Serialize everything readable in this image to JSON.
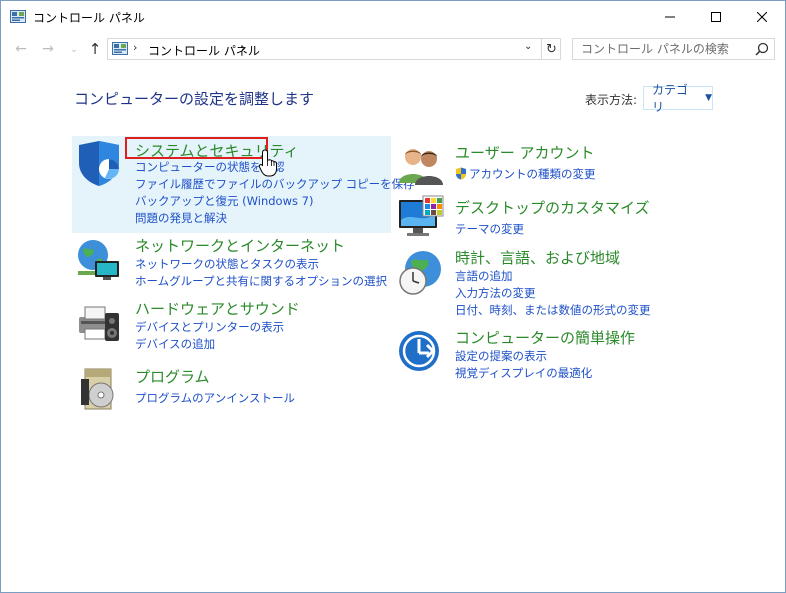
{
  "window": {
    "title": "コントロール パネル",
    "controls": {
      "minimize": "—",
      "maximize": "☐",
      "close": "✕"
    }
  },
  "nav": {
    "back": "←",
    "forward": "→",
    "recent": "⌄",
    "up": "↑",
    "address_sep": "›",
    "address_location": "コントロール パネル",
    "address_dropdown": "⌄",
    "refresh": "↻",
    "search_placeholder": "コントロール パネルの検索"
  },
  "main": {
    "heading": "コンピューターの設定を調整します",
    "view_by_label": "表示方法:",
    "view_by_value": "カテゴリ"
  },
  "categories_left": [
    {
      "title": "システムとセキュリティ",
      "icon": "shield-icon",
      "links": [
        "コンピューターの状態を確認",
        "ファイル履歴でファイルのバックアップ コピーを保存",
        "バックアップと復元 (Windows 7)",
        "問題の発見と解決"
      ]
    },
    {
      "title": "ネットワークとインターネット",
      "icon": "network-globe-icon",
      "links": [
        "ネットワークの状態とタスクの表示",
        "ホームグループと共有に関するオプションの選択"
      ]
    },
    {
      "title": "ハードウェアとサウンド",
      "icon": "printer-speaker-icon",
      "links": [
        "デバイスとプリンターの表示",
        "デバイスの追加"
      ]
    },
    {
      "title": "プログラム",
      "icon": "program-disc-icon",
      "links": [
        "プログラムのアンインストール"
      ]
    }
  ],
  "categories_right": [
    {
      "title": "ユーザー アカウント",
      "icon": "users-icon",
      "links": [
        "アカウントの種類の変更"
      ]
    },
    {
      "title": "デスクトップのカスタマイズ",
      "icon": "monitor-palette-icon",
      "links": [
        "テーマの変更"
      ]
    },
    {
      "title": "時計、言語、および地域",
      "icon": "clock-globe-icon",
      "links": [
        "言語の追加",
        "入力方法の変更",
        "日付、時刻、または数値の形式の変更"
      ]
    },
    {
      "title": "コンピューターの簡単操作",
      "icon": "ease-of-access-icon",
      "links": [
        "設定の提案の表示",
        "視覚ディスプレイの最適化"
      ]
    }
  ],
  "colors": {
    "heading": "#1e3287",
    "category_title": "#2a8a2a",
    "link": "#1e50c8",
    "highlight": "#e5f3fb",
    "red_box": "#e01e1e"
  }
}
